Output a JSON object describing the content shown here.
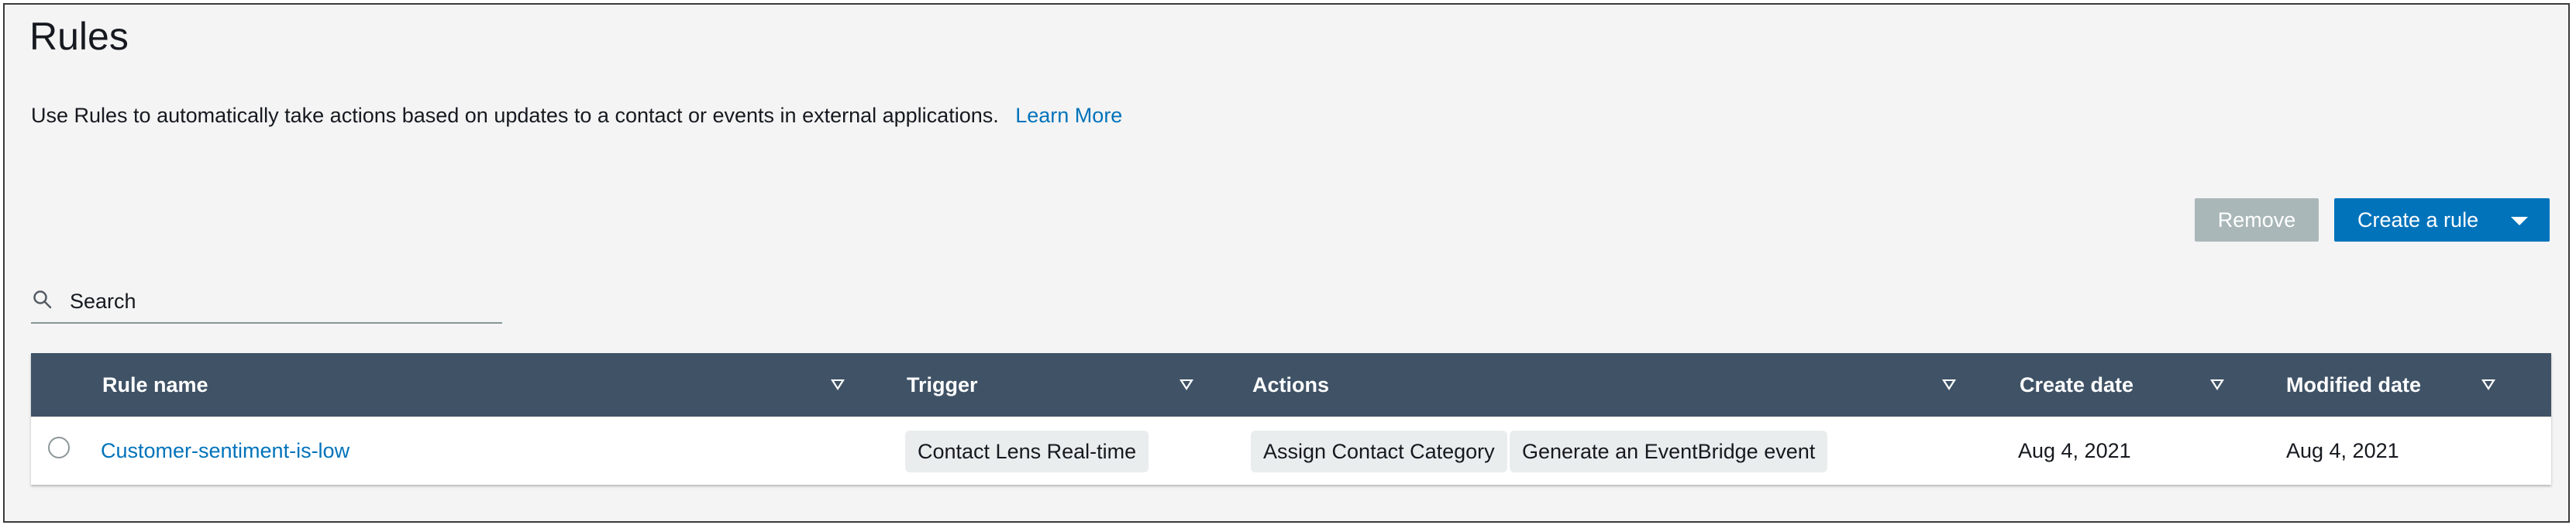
{
  "page": {
    "title": "Rules",
    "description": "Use Rules to automatically take actions based on updates to a contact or events in external applications.",
    "learn_more": "Learn More"
  },
  "toolbar": {
    "remove_label": "Remove",
    "create_label": "Create a rule"
  },
  "search": {
    "placeholder": "Search"
  },
  "table": {
    "columns": [
      "Rule name",
      "Trigger",
      "Actions",
      "Create date",
      "Modified date"
    ],
    "rows": [
      {
        "rule_name": "Customer-sentiment-is-low",
        "trigger": "Contact Lens Real-time",
        "actions": [
          "Assign Contact Category",
          "Generate an EventBridge event"
        ],
        "create_date": "Aug 4, 2021",
        "modified_date": "Aug 4, 2021"
      }
    ]
  },
  "colors": {
    "accent": "#0073bb",
    "header_bg": "#3f5266",
    "disabled_button": "#aab7b8",
    "page_bg": "#f4f4f4",
    "chip_bg": "#eaeded"
  }
}
